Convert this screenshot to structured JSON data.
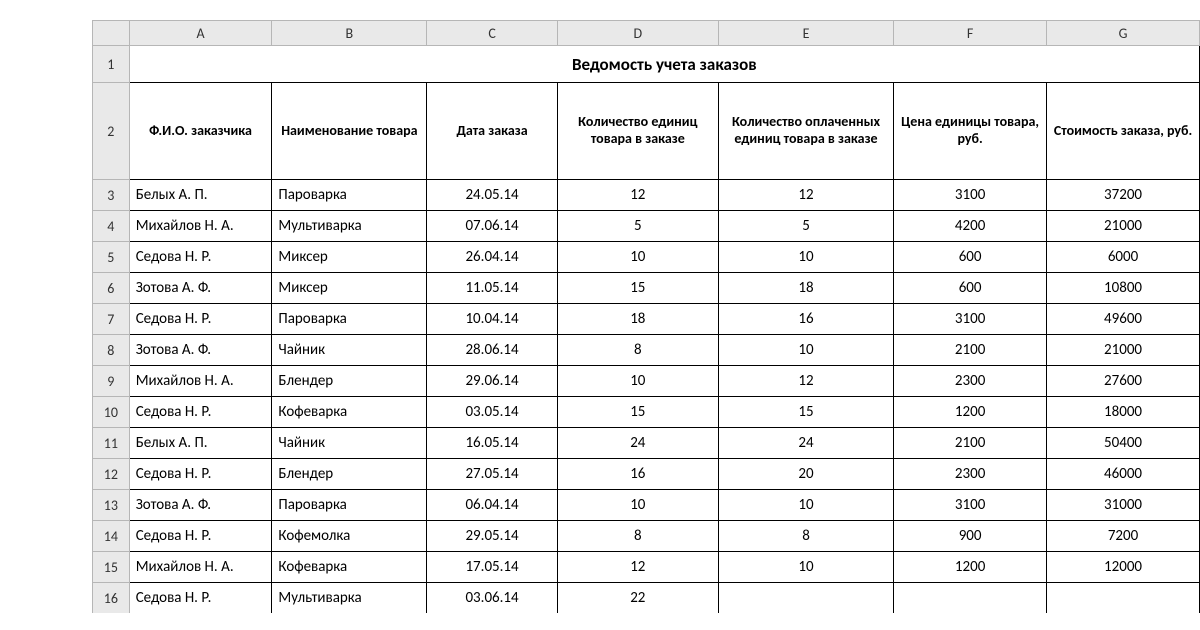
{
  "columns": [
    "A",
    "B",
    "C",
    "D",
    "E",
    "F",
    "G"
  ],
  "title": "Ведомость учета заказов",
  "headers": {
    "A": "Ф.И.О. заказчика",
    "B": "Наименование товара",
    "C": "Дата заказа",
    "D": "Количество единиц товара в заказе",
    "E": "Количество оплаченных единиц товара в заказе",
    "F": "Цена единицы товара, руб.",
    "G": "Стоимость заказа, руб."
  },
  "rows": [
    {
      "n": 3,
      "A": "Белых А. П.",
      "B": "Пароварка",
      "C": "24.05.14",
      "D": "12",
      "E": "12",
      "F": "3100",
      "G": "37200"
    },
    {
      "n": 4,
      "A": "Михайлов Н. А.",
      "B": "Мультиварка",
      "C": "07.06.14",
      "D": "5",
      "E": "5",
      "F": "4200",
      "G": "21000"
    },
    {
      "n": 5,
      "A": "Седова Н. Р.",
      "B": "Миксер",
      "C": "26.04.14",
      "D": "10",
      "E": "10",
      "F": "600",
      "G": "6000"
    },
    {
      "n": 6,
      "A": "Зотова А. Ф.",
      "B": "Миксер",
      "C": "11.05.14",
      "D": "15",
      "E": "18",
      "F": "600",
      "G": "10800"
    },
    {
      "n": 7,
      "A": "Седова Н. Р.",
      "B": "Пароварка",
      "C": "10.04.14",
      "D": "18",
      "E": "16",
      "F": "3100",
      "G": "49600"
    },
    {
      "n": 8,
      "A": "Зотова А. Ф.",
      "B": "Чайник",
      "C": "28.06.14",
      "D": "8",
      "E": "10",
      "F": "2100",
      "G": "21000"
    },
    {
      "n": 9,
      "A": "Михайлов Н. А.",
      "B": "Блендер",
      "C": "29.06.14",
      "D": "10",
      "E": "12",
      "F": "2300",
      "G": "27600"
    },
    {
      "n": 10,
      "A": "Седова Н. Р.",
      "B": "Кофеварка",
      "C": "03.05.14",
      "D": "15",
      "E": "15",
      "F": "1200",
      "G": "18000"
    },
    {
      "n": 11,
      "A": "Белых А. П.",
      "B": "Чайник",
      "C": "16.05.14",
      "D": "24",
      "E": "24",
      "F": "2100",
      "G": "50400"
    },
    {
      "n": 12,
      "A": "Седова Н. Р.",
      "B": "Блендер",
      "C": "27.05.14",
      "D": "16",
      "E": "20",
      "F": "2300",
      "G": "46000"
    },
    {
      "n": 13,
      "A": "Зотова А. Ф.",
      "B": "Пароварка",
      "C": "06.04.14",
      "D": "10",
      "E": "10",
      "F": "3100",
      "G": "31000"
    },
    {
      "n": 14,
      "A": "Седова Н. Р.",
      "B": "Кофемолка",
      "C": "29.05.14",
      "D": "8",
      "E": "8",
      "F": "900",
      "G": "7200"
    },
    {
      "n": 15,
      "A": "Михайлов Н. А.",
      "B": "Кофеварка",
      "C": "17.05.14",
      "D": "12",
      "E": "10",
      "F": "1200",
      "G": "12000"
    },
    {
      "n": 16,
      "A": "Седова Н. Р.",
      "B": "Мультиварка",
      "C": "03.06.14",
      "D": "22",
      "E": "",
      "F": "",
      "G": ""
    }
  ],
  "col_widths": {
    "rowhead": 36,
    "A": 140,
    "B": 152,
    "C": 128,
    "D": 158,
    "E": 172,
    "F": 150,
    "G": 150
  }
}
